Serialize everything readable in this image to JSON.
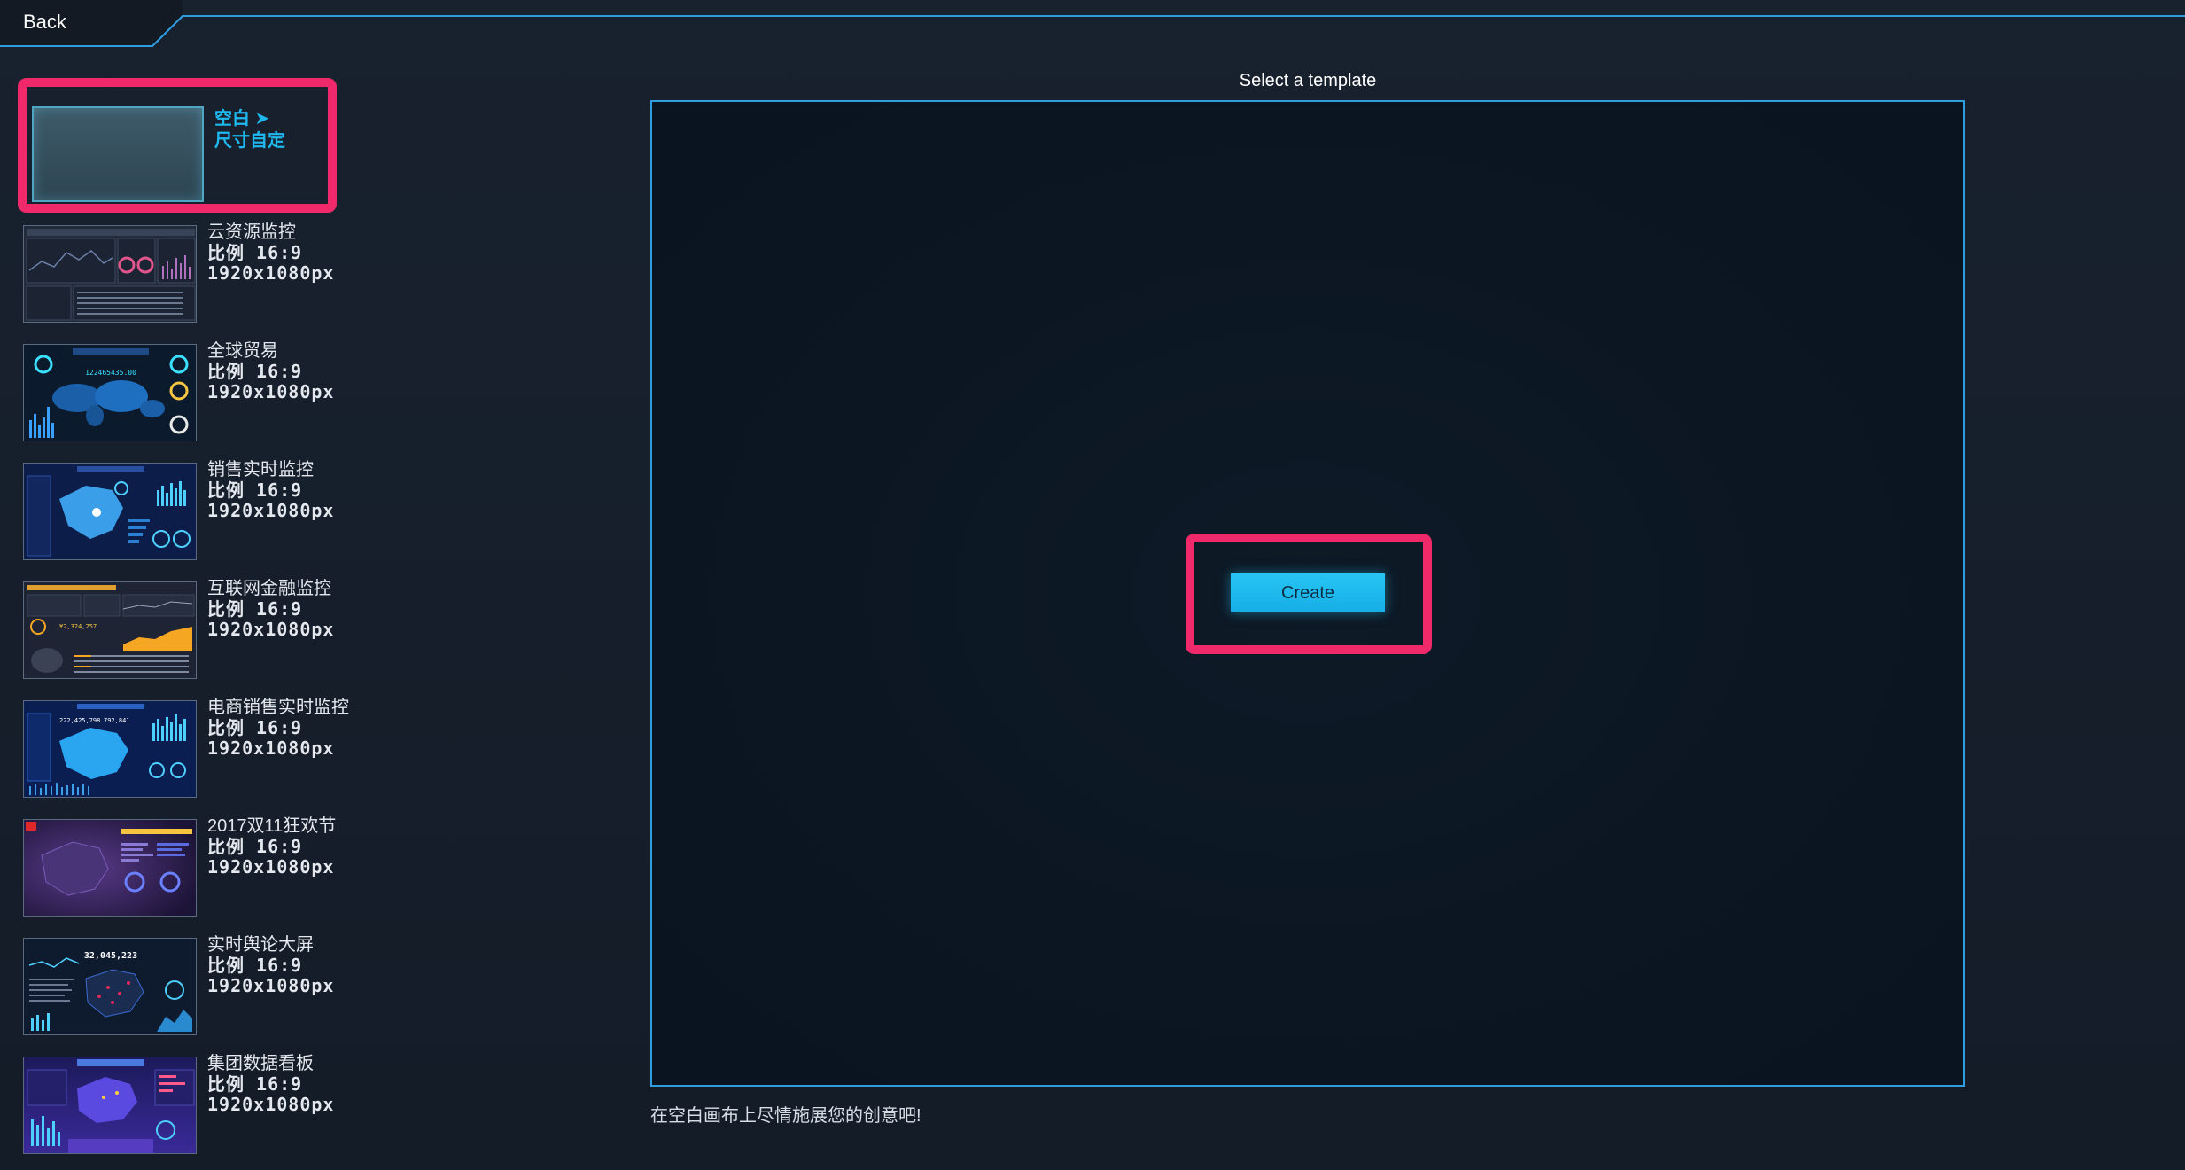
{
  "header": {
    "back_label": "Back"
  },
  "main": {
    "title": "Select a template",
    "create_label": "Create",
    "hint": "在空白画布上尽情施展您的创意吧!"
  },
  "blank_template": {
    "line1": "空白 ➤",
    "line2": "尺寸自定"
  },
  "templates": [
    {
      "name": "云资源监控",
      "ratio": "比例 16:9",
      "size": "1920x1080px",
      "theme": "cloud"
    },
    {
      "name": "全球贸易",
      "ratio": "比例 16:9",
      "size": "1920x1080px",
      "theme": "trade"
    },
    {
      "name": "销售实时监控",
      "ratio": "比例 16:9",
      "size": "1920x1080px",
      "theme": "sales"
    },
    {
      "name": "互联网金融监控",
      "ratio": "比例 16:9",
      "size": "1920x1080px",
      "theme": "finance"
    },
    {
      "name": "电商销售实时监控",
      "ratio": "比例 16:9",
      "size": "1920x1080px",
      "theme": "ecommerce"
    },
    {
      "name": "2017双11狂欢节",
      "ratio": "比例 16:9",
      "size": "1920x1080px",
      "theme": "double11"
    },
    {
      "name": "实时舆论大屏",
      "ratio": "比例 16:9",
      "size": "1920x1080px",
      "theme": "opinion"
    },
    {
      "name": "集团数据看板",
      "ratio": "比例 16:9",
      "size": "1920x1080px",
      "theme": "group"
    }
  ],
  "colors": {
    "accent": "#2e9ee0",
    "highlight": "#f02a6a",
    "button": "#1fb8ee"
  }
}
